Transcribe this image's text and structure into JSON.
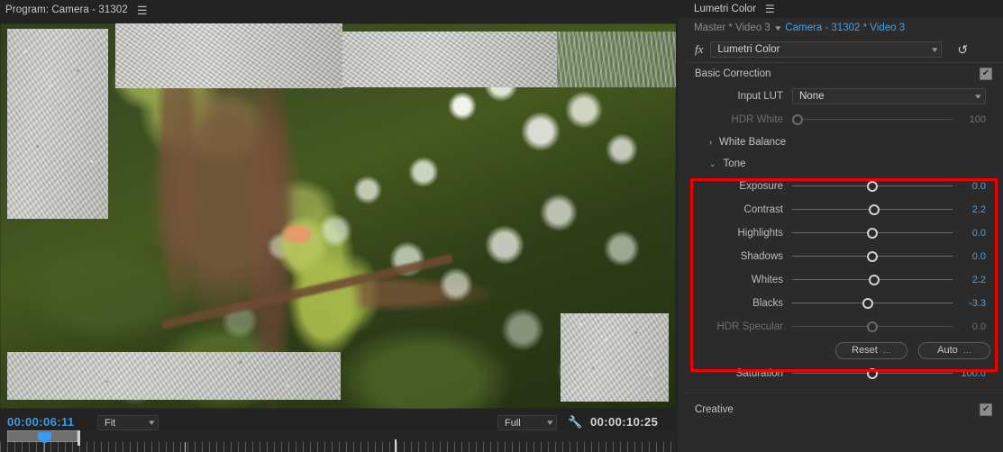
{
  "program_monitor": {
    "title": "Program: Camera - 31302",
    "menu_icon": "hamburger-menu-icon",
    "current_timecode": "00:00:06:11",
    "duration_timecode": "00:00:10:25",
    "zoom_level": {
      "value": "Fit",
      "chevron": "chevron-down-icon"
    },
    "playback_resolution": {
      "value": "Full",
      "chevron": "chevron-down-icon"
    },
    "settings_icon": "wrench-icon",
    "frame_description": "Blurred green foliage with bokeh highlights, a brown branch and a yellow-green parrot, partially covered by grey pavement and gravel overlay crops"
  },
  "lumetri": {
    "panel_title": "Lumetri Color",
    "panel_menu_icon": "hamburger-menu-icon",
    "clip_bar": {
      "master_label": "Master * Video 3",
      "caret_icon": "chevron-down-icon",
      "clip_label": "Camera - 31302 * Video 3"
    },
    "effect_row": {
      "fx_icon": "fx-icon",
      "effect_name": "Lumetri Color",
      "chevron": "chevron-down-icon",
      "reset_icon": "reset-arrow-icon"
    },
    "basic_correction": {
      "label": "Basic Correction",
      "enabled": true,
      "input_lut": {
        "label": "Input LUT",
        "value": "None",
        "chevron": "chevron-down-icon"
      },
      "hdr_white": {
        "label": "HDR White",
        "value": "100",
        "percent": 2,
        "disabled": true
      },
      "white_balance": {
        "label": "White Balance",
        "expanded": false,
        "tri": "›"
      },
      "tone": {
        "label": "Tone",
        "expanded": true,
        "tri": "⌄",
        "params": [
          {
            "label": "Exposure",
            "value": "0.0",
            "percent": 50,
            "disabled": false
          },
          {
            "label": "Contrast",
            "value": "2.2",
            "percent": 51,
            "disabled": false
          },
          {
            "label": "Highlights",
            "value": "0.0",
            "percent": 50,
            "disabled": false
          },
          {
            "label": "Shadows",
            "value": "0.0",
            "percent": 50,
            "disabled": false
          },
          {
            "label": "Whites",
            "value": "2.2",
            "percent": 51,
            "disabled": false
          },
          {
            "label": "Blacks",
            "value": "-3.3",
            "percent": 47,
            "disabled": false
          },
          {
            "label": "HDR Specular",
            "value": "0.0",
            "percent": 50,
            "disabled": true
          }
        ],
        "reset_button": "Reset",
        "auto_button": "Auto"
      },
      "saturation": {
        "label": "Saturation",
        "value": "100.0",
        "percent": 50,
        "disabled": false
      }
    },
    "creative": {
      "label": "Creative",
      "enabled": true
    }
  },
  "annotation": {
    "highlight_color": "#ee0000",
    "target": "tone-section"
  },
  "colors": {
    "panel_bg": "#2b2b2b",
    "header_bg": "#232323",
    "accent_blue": "#4a9fe0",
    "timecode_blue": "#3c9ae8",
    "text": "#c8c8c8",
    "text_dim": "#6e6e6e",
    "highlight_red": "#ee0000"
  }
}
